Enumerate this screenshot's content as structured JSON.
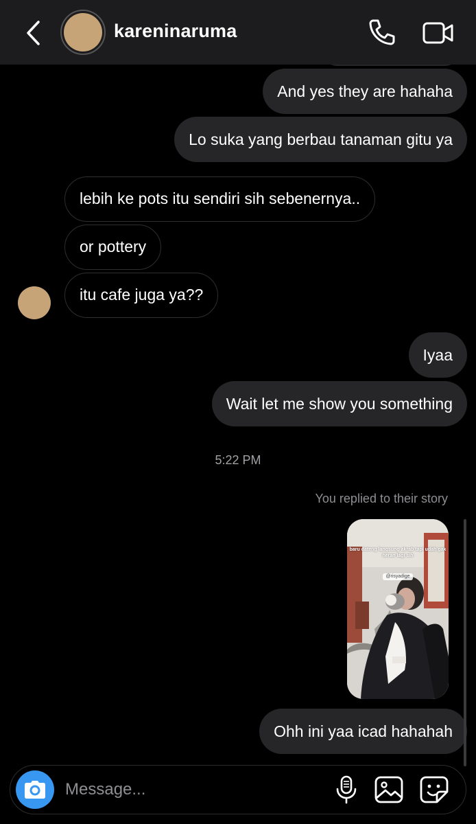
{
  "header": {
    "username": "kareninaruma",
    "icons": {
      "back": "chevron-left-icon",
      "call": "phone-icon",
      "video": "video-camera-icon"
    },
    "avatar_color": "#c7a478"
  },
  "messages": [
    {
      "direction": "outgoing",
      "text": "And yes they are hahaha"
    },
    {
      "direction": "outgoing",
      "text": "Lo suka yang berbau tanaman gitu ya"
    },
    {
      "direction": "incoming",
      "text": "lebih ke pots itu sendiri sih sebenernya.."
    },
    {
      "direction": "incoming",
      "text": "or pottery"
    },
    {
      "direction": "incoming",
      "text": "itu cafe juga ya??"
    },
    {
      "direction": "outgoing",
      "text": "Iyaa"
    },
    {
      "direction": "outgoing",
      "text": "Wait let me show you something"
    },
    {
      "direction": "outgoing",
      "text": "Ohh ini yaa icad hahahah"
    }
  ],
  "timestamp": "5:22 PM",
  "story_reply": {
    "caption": "You replied to their story",
    "story_text": "baru dateng langsung akrab tapi udah gak heran lagi sih",
    "mention": "@risyadige"
  },
  "composer": {
    "placeholder": "Message...",
    "icons": {
      "camera": "camera-icon",
      "mic": "microphone-icon",
      "gallery": "image-icon",
      "sticker": "sticker-icon"
    },
    "camera_color": "#3897f0"
  },
  "colors": {
    "background": "#000000",
    "header": "#1c1c1e",
    "outgoing_bubble": "#262628",
    "incoming_border": "#2e2e30"
  }
}
